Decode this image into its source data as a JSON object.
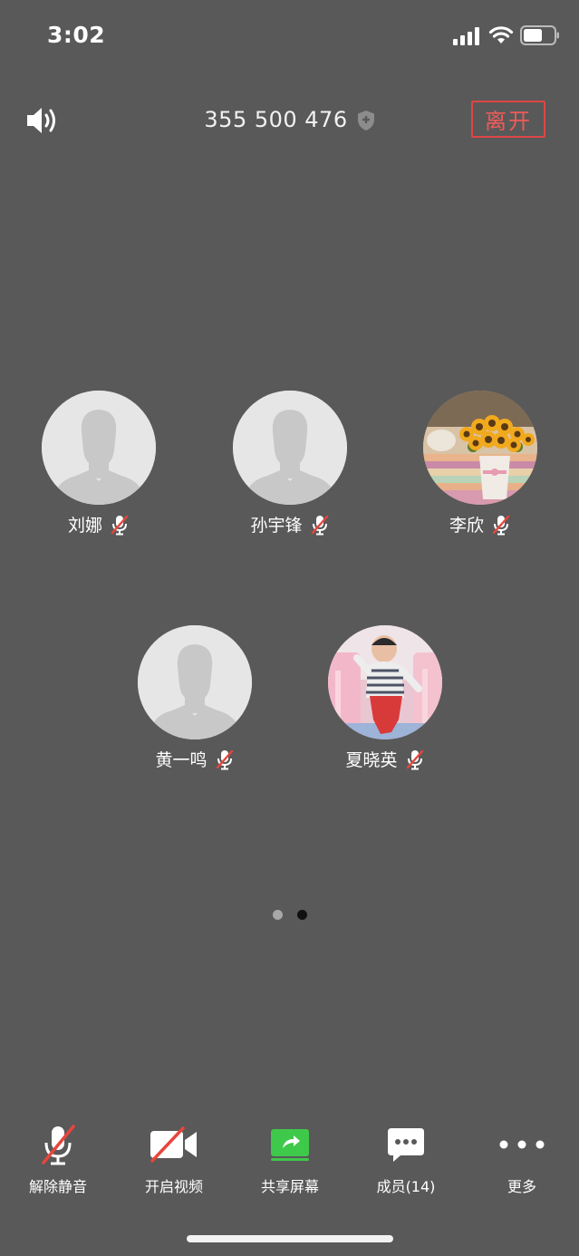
{
  "status_bar": {
    "time": "3:02"
  },
  "header": {
    "meeting_id": "355 500 476",
    "leave_label": "离开"
  },
  "participants": [
    {
      "name": "刘娜",
      "avatar": "default-person-icon",
      "muted": true
    },
    {
      "name": "孙宇锋",
      "avatar": "default-person-icon",
      "muted": true
    },
    {
      "name": "李欣",
      "avatar": "sunflower-photo",
      "muted": true
    },
    {
      "name": "黄一鸣",
      "avatar": "default-person-icon",
      "muted": true
    },
    {
      "name": "夏晓英",
      "avatar": "baby-photo",
      "muted": true
    }
  ],
  "pagination": {
    "pages": 2,
    "current": 2
  },
  "toolbar": {
    "unmute_label": "解除静音",
    "video_label": "开启视频",
    "share_label": "共享屏幕",
    "members_label": "成员(14)",
    "more_label": "更多"
  },
  "colors": {
    "background": "#595959",
    "leave_red": "#e04545",
    "share_green": "#3fc94a",
    "mute_red": "#e8453c"
  }
}
